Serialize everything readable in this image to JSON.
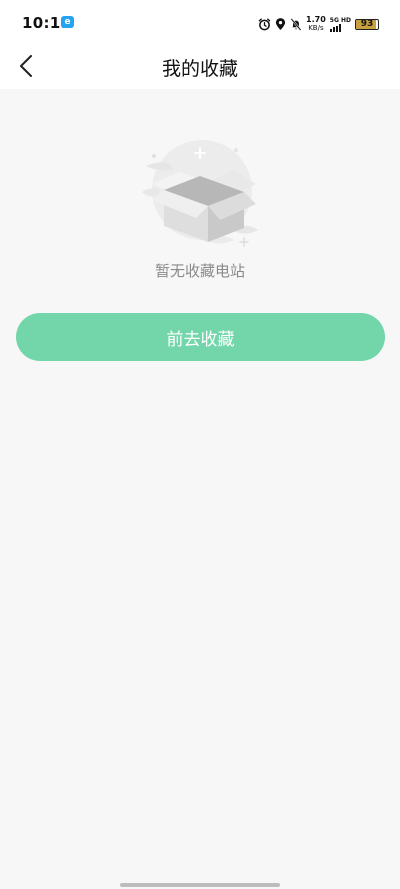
{
  "status_bar": {
    "time": "10:15",
    "app_badge": "e",
    "net_speed_value": "1.70",
    "net_speed_unit": "KB/s",
    "signal_label": "5G HD",
    "battery_level": "93",
    "battery_color": "#c8a13e"
  },
  "nav": {
    "back_icon": "chevron-left-icon",
    "title": "我的收藏"
  },
  "empty_state": {
    "illustration_icon": "empty-box-icon",
    "message": "暂无收藏电站"
  },
  "cta": {
    "label": "前去收藏",
    "color": "#72d6aa"
  }
}
